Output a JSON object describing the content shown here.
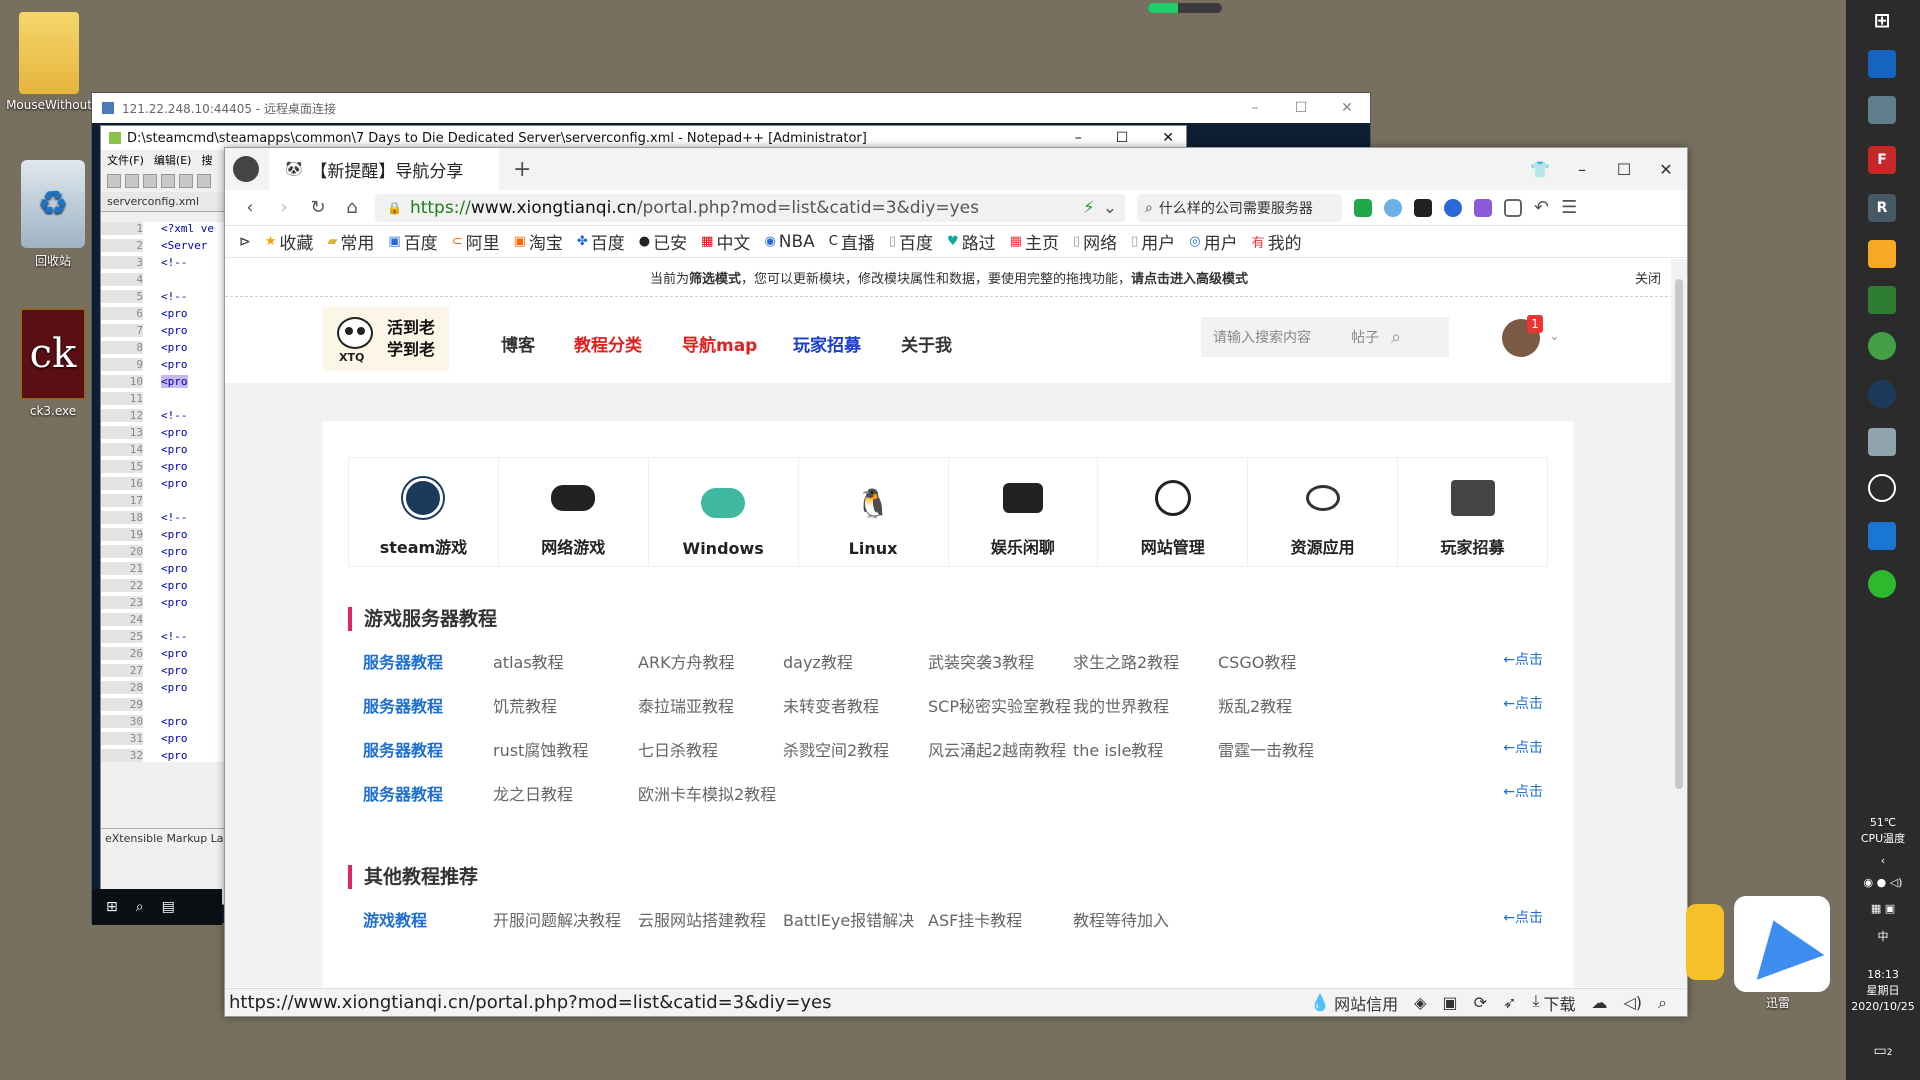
{
  "desktop": {
    "icons": [
      {
        "label": "MouseWithout"
      },
      {
        "label": "回收站"
      },
      {
        "label": "ck3.exe"
      }
    ]
  },
  "rdp": {
    "title": "121.22.248.10:44405 - 远程桌面连接",
    "controls": [
      "–",
      "☐",
      "✕"
    ]
  },
  "notepad": {
    "title": "D:\\steamcmd\\steamapps\\common\\7 Days to Die Dedicated Server\\serverconfig.xml - Notepad++ [Administrator]",
    "menu": [
      "文件(F)",
      "编辑(E)",
      "搜"
    ],
    "tab": "serverconfig.xml",
    "lines": [
      "1",
      "2",
      "3",
      "4",
      "5",
      "6",
      "7",
      "8",
      "9",
      "10",
      "11",
      "12",
      "13",
      "14",
      "15",
      "16",
      "17",
      "18",
      "19",
      "20",
      "21",
      "22",
      "23",
      "24",
      "25",
      "26",
      "27",
      "28",
      "29",
      "30",
      "31",
      "32"
    ],
    "code": [
      "<?xml ve",
      "<Server",
      "<!--",
      "",
      "<!--",
      "<pro",
      "<pro",
      "<pro",
      "<pro",
      "<pro",
      "",
      "<!--",
      "<pro",
      "<pro",
      "<pro",
      "<pro",
      "",
      "<!--",
      "<pro",
      "<pro",
      "<pro",
      "<pro",
      "<pro",
      "",
      "<!--",
      "<pro",
      "<pro",
      "<pro",
      "",
      "<pro",
      "<pro",
      "<pro"
    ],
    "status": "eXtensible Markup La"
  },
  "browser": {
    "tab_title": "【新提醒】导航分享",
    "url_scheme": "https://",
    "url_domain": "www.xiongtianqi.cn",
    "url_path": "/portal.php?mod=list&catid=3&diy=yes",
    "search_text": "什么样的公司需要服务器",
    "bookmarks": [
      "收藏",
      "常用",
      "百度",
      "阿里",
      "淘宝",
      "百度",
      "已安",
      "中文",
      "NBA",
      "直播",
      "百度",
      "路过",
      "主页",
      "网络",
      "用户",
      "用户",
      "我的"
    ],
    "status_url": "https://www.xiongtianqi.cn/portal.php?mod=list&catid=3&diy=yes",
    "status_right": [
      "网站信用",
      "下载"
    ]
  },
  "page": {
    "notice_prefix": "当前为",
    "notice_mode": "筛选模式",
    "notice_mid": "，您可以更新模块，修改模块属性和数据，要使用完整的拖拽功能，",
    "notice_link": "请点击进入高级模式",
    "notice_close": "关闭",
    "logo_line1": "活到老",
    "logo_line2": "学到老",
    "logo_small": "XTQ",
    "nav": [
      "博客",
      "教程分类",
      "导航map",
      "玩家招募",
      "关于我"
    ],
    "search_placeholder": "请输入搜索内容",
    "search_scope": "帖子",
    "avatar_badge": "1",
    "categories": [
      "steam游戏",
      "网络游戏",
      "Windows",
      "Linux",
      "娱乐闲聊",
      "网站管理",
      "资源应用",
      "玩家招募"
    ],
    "section1": "游戏服务器教程",
    "rows1": [
      [
        "服务器教程",
        "atlas教程",
        "ARK方舟教程",
        "dayz教程",
        "武装突袭3教程",
        "求生之路2教程",
        "CSGO教程",
        "←点击"
      ],
      [
        "服务器教程",
        "饥荒教程",
        "泰拉瑞亚教程",
        "未转变者教程",
        "SCP秘密实验室教程",
        "我的世界教程",
        "叛乱2教程",
        "←点击"
      ],
      [
        "服务器教程",
        "rust腐蚀教程",
        "七日杀教程",
        "杀戮空间2教程",
        "风云涌起2越南教程",
        "the isle教程",
        "雷霆一击教程",
        "←点击"
      ],
      [
        "服务器教程",
        "龙之日教程",
        "欧洲卡车模拟2教程",
        "",
        "",
        "",
        "",
        "←点击"
      ]
    ],
    "section2": "其他教程推荐",
    "rows2": [
      [
        "游戏教程",
        "开服问题解决教程",
        "云服网站搭建教程",
        "BattlEye报错解决",
        "ASF挂卡教程",
        "教程等待加入",
        "",
        "←点击"
      ]
    ]
  },
  "taskbar": {
    "temp": "51℃",
    "temp_label": "CPU温度",
    "ime": "中",
    "time": "18:13",
    "weekday": "星期日",
    "date": "2020/10/25",
    "app_label": "迅雷",
    "notif_count": "2"
  }
}
